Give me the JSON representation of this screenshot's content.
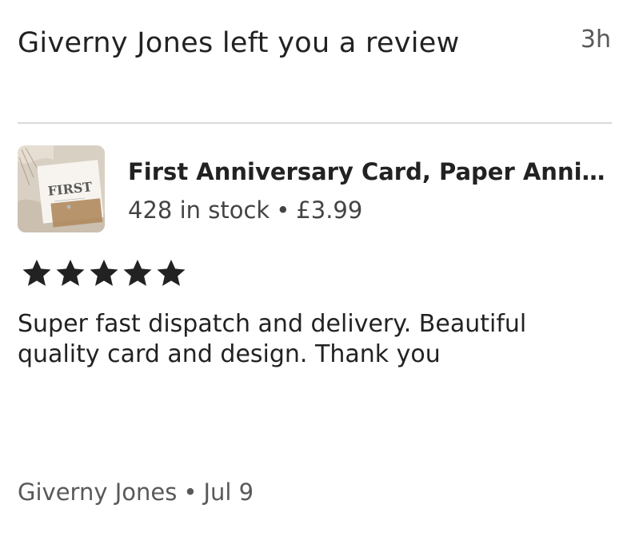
{
  "notification": {
    "title": "Giverny Jones left you a review",
    "time": "3h"
  },
  "listing": {
    "title": "First Anniversary Card, Paper Anniv...",
    "stock": "428 in stock",
    "separator": "•",
    "price": "£3.99",
    "thumbnail_text": "FIRST"
  },
  "review": {
    "rating": 5,
    "max_rating": 5,
    "star_color": "#222222",
    "text": "Super fast dispatch and delivery. Beautiful quality card and design. Thank you"
  },
  "footer": {
    "reviewer": "Giverny Jones",
    "separator": "•",
    "date": "Jul 9"
  }
}
